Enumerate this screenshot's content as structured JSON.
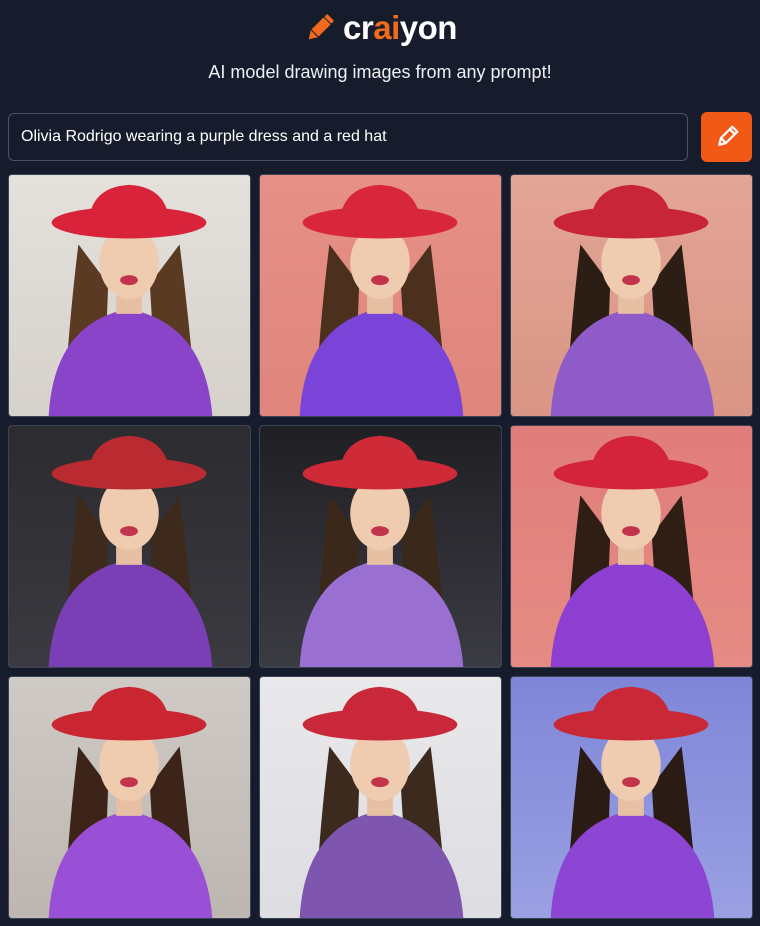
{
  "logo": {
    "prefix": "cr",
    "accent": "ai",
    "suffix": "yon",
    "icon": "pencil-icon"
  },
  "tagline": "AI model drawing images from any prompt!",
  "prompt": {
    "value": "Olivia Rodrigo wearing a purple dress and a red hat",
    "placeholder": ""
  },
  "draw_button": {
    "icon": "pencil-icon",
    "color": "#f05a16"
  },
  "colors": {
    "background": "#161c2b",
    "accent": "#f26b1d"
  },
  "images": [
    {
      "bg": "#e4e0db",
      "bgBottom": "#d6d1cb",
      "hat": "#d8233a",
      "dress": "#8a44c9",
      "hair": "#5a3a22"
    },
    {
      "bg": "#e69087",
      "bgBottom": "#df857b",
      "hat": "#d8263a",
      "dress": "#7a44d8",
      "hair": "#4a301d"
    },
    {
      "bg": "#e3a596",
      "bgBottom": "#d99585",
      "hat": "#c9253a",
      "dress": "#8f5bc8",
      "hair": "#2c1d15"
    },
    {
      "bg": "#2b2b30",
      "bgBottom": "#3a3a40",
      "hat": "#b92a31",
      "dress": "#7b3fb5",
      "hair": "#3e2a1c"
    },
    {
      "bg": "#1f1f24",
      "bgBottom": "#3b3b42",
      "hat": "#cf2a37",
      "dress": "#9a6fd2",
      "hair": "#3a281b"
    },
    {
      "bg": "#e07d7a",
      "bgBottom": "#e58b84",
      "hat": "#d3243b",
      "dress": "#8c3fd0",
      "hair": "#2e1e14"
    },
    {
      "bg": "#cfcac6",
      "bgBottom": "#bdb6b1",
      "hat": "#c92632",
      "dress": "#9a50d6",
      "hair": "#3d2418"
    },
    {
      "bg": "#e9e8ea",
      "bgBottom": "#dddde2",
      "hat": "#c9283a",
      "dress": "#7e56b0",
      "hair": "#3b2a1d"
    },
    {
      "bg": "#7f86d8",
      "bgBottom": "#9aa0e2",
      "hat": "#c92936",
      "dress": "#8d46d4",
      "hair": "#2a1c14"
    }
  ]
}
